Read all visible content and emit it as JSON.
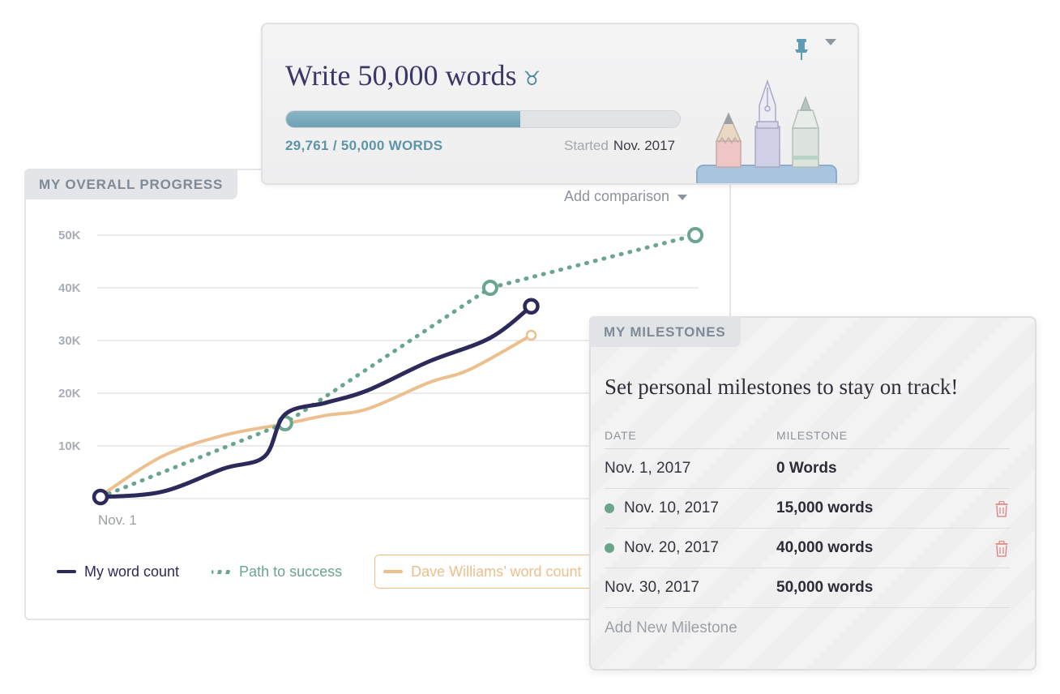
{
  "goal": {
    "title": "Write 50,000 words",
    "sign_icon": "taurus-icon",
    "progress_fraction": 0.5952,
    "words_label": "29,761 / 50,000 WORDS",
    "started_label": "Started",
    "started_value": "Nov. 2017",
    "pin_icon": "pin-icon",
    "menu_icon": "caret-down-icon",
    "illustration": "pencil-pen-brush-illustration"
  },
  "progress": {
    "tab_label": "MY OVERALL PROGRESS",
    "add_comparison": "Add comparison",
    "legend": {
      "mine": "My word count",
      "path": "Path to success",
      "dave": "Dave Williams’ word count"
    }
  },
  "chart_data": {
    "type": "line",
    "title": "",
    "xlabel": "",
    "ylabel": "",
    "y_ticks": [
      "50K",
      "40K",
      "30K",
      "20K",
      "10K"
    ],
    "x_tick_label": "Nov. 1",
    "xlim": [
      1,
      30
    ],
    "ylim": [
      0,
      50000
    ],
    "grid": true,
    "series": [
      {
        "name": "My word count",
        "color": "#2c2a5a",
        "style": "solid",
        "x": [
          1,
          4,
          7,
          9,
          10,
          12,
          14,
          17,
          20,
          22
        ],
        "y": [
          300,
          1300,
          5700,
          8000,
          16000,
          18200,
          20500,
          26000,
          30500,
          36500
        ]
      },
      {
        "name": "Path to success",
        "color": "#6aa58e",
        "style": "dotted",
        "x": [
          1,
          10,
          20,
          30
        ],
        "y": [
          300,
          14300,
          40000,
          50000
        ],
        "markers": [
          10,
          20,
          30
        ]
      },
      {
        "name": "Dave Williams’ word count",
        "color": "#ecbf8c",
        "style": "solid",
        "x": [
          1,
          4,
          7,
          10,
          12,
          14,
          17,
          19,
          22
        ],
        "y": [
          500,
          8000,
          12000,
          14200,
          15800,
          17000,
          22000,
          24500,
          31000
        ]
      }
    ]
  },
  "milestones": {
    "tab_label": "MY MILESTONES",
    "heading": "Set personal milestones to stay on track!",
    "col_date": "DATE",
    "col_milestone": "MILESTONE",
    "rows": [
      {
        "date": "Nov. 1, 2017",
        "milestone": "0 Words"
      },
      {
        "date": "Nov. 10, 2017",
        "milestone": "15,000 words"
      },
      {
        "date": "Nov. 20, 2017",
        "milestone": "40,000 words"
      },
      {
        "date": "Nov. 30, 2017",
        "milestone": "50,000 words"
      }
    ],
    "add_label": "Add New Milestone",
    "dot_color": "#6aa58e",
    "trash_color": "#e08a8a"
  }
}
